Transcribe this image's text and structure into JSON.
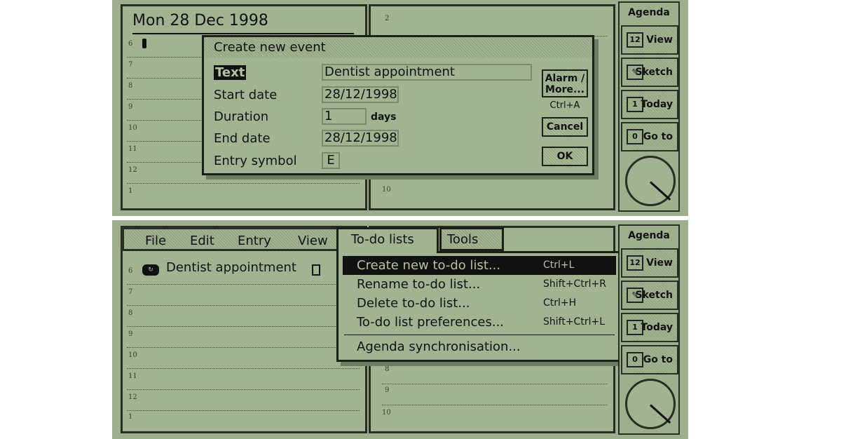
{
  "colors": {
    "screen": "#9fae8c",
    "ink": "#111111"
  },
  "top": {
    "date": "Mon 28 Dec 1998",
    "hours_left": [
      "6",
      "7",
      "8",
      "9",
      "10",
      "11",
      "12",
      "1"
    ],
    "hours_right": [
      "2",
      "10"
    ],
    "dialog": {
      "title": "Create new event",
      "fields": [
        {
          "label": "Text",
          "value": "Dentist appointment"
        },
        {
          "label": "Start date",
          "value": "28/12/1998"
        },
        {
          "label": "Duration",
          "value": "1",
          "unit": "days"
        },
        {
          "label": "End date",
          "value": "28/12/1998"
        },
        {
          "label": "Entry symbol",
          "value": "E"
        }
      ],
      "alarm_button": "Alarm / More...",
      "alarm_shortcut": "Ctrl+A",
      "cancel_button": "Cancel",
      "ok_button": "OK"
    }
  },
  "bottom": {
    "menubar": [
      "File",
      "Edit",
      "Entry",
      "View",
      "To-do lists",
      "Tools"
    ],
    "entry": {
      "hour": "6",
      "text": "Dentist appointment",
      "icon": "recurring-event-icon"
    },
    "hours_left": [
      "6",
      "7",
      "8",
      "9",
      "10",
      "11",
      "12",
      "1"
    ],
    "hours_right": [
      "8",
      "9",
      "10"
    ],
    "menu": [
      {
        "label": "Create new to-do list...",
        "shortcut": "Ctrl+L",
        "selected": true
      },
      {
        "label": "Rename to-do list...",
        "shortcut": "Shift+Ctrl+R"
      },
      {
        "label": "Delete to-do list...",
        "shortcut": "Ctrl+H"
      },
      {
        "label": "To-do list preferences...",
        "shortcut": "Shift+Ctrl+L"
      },
      {
        "label": "Agenda synchronisation...",
        "shortcut": ""
      }
    ]
  },
  "sidebar": {
    "title": "Agenda",
    "buttons": [
      {
        "label": "View",
        "icon": "calendar-stack-icon"
      },
      {
        "label": "Sketch",
        "icon": "sketch-book-icon"
      },
      {
        "label": "Today",
        "icon": "today-calendar-icon"
      },
      {
        "label": "Go to",
        "icon": "goto-calendar-icon"
      }
    ],
    "clock_icon": "analog-clock-icon"
  }
}
